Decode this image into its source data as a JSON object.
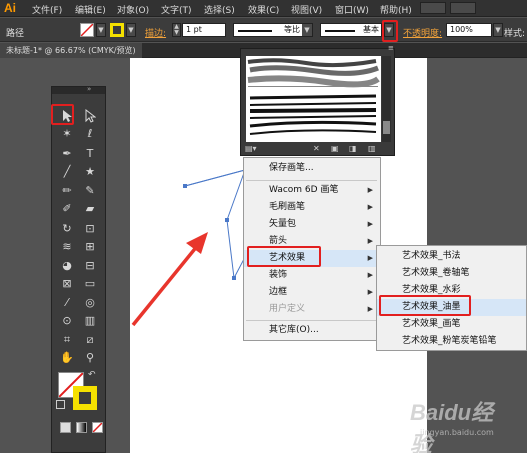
{
  "app": {
    "logo": "Ai"
  },
  "menubar": {
    "items": [
      "文件(F)",
      "编辑(E)",
      "对象(O)",
      "文字(T)",
      "选择(S)",
      "效果(C)",
      "视图(V)",
      "窗口(W)",
      "帮助(H)"
    ]
  },
  "control_bar": {
    "path_label": "路径",
    "stroke_label": "描边:",
    "stroke_weight": "1 pt",
    "profile_label": "等比",
    "brush_label": "基本",
    "opacity_label": "不透明度:",
    "opacity_value": "100%",
    "style_label": "样式:"
  },
  "doc_tab": {
    "title": "未标题-1* @ 66.67% (CMYK/预览)"
  },
  "context_menu": {
    "items": [
      "保存画笔...",
      "Wacom 6D 画笔",
      "毛刷画笔",
      "矢量包",
      "箭头",
      "艺术效果",
      "装饰",
      "边框",
      "用户定义",
      "其它库(O)..."
    ],
    "submenu_arrow": "▶"
  },
  "art_submenu": {
    "items": [
      "艺术效果_书法",
      "艺术效果_卷轴笔",
      "艺术效果_水彩",
      "艺术效果_油墨",
      "艺术效果_画笔",
      "艺术效果_粉笔炭笔铅笔"
    ]
  },
  "colors": {
    "accent_orange": "#ff9a00",
    "highlight_red": "#e21f1f",
    "arrow_red": "#e8352c",
    "path_blue": "#4a78c8",
    "fill_yellow": "#f5e100"
  },
  "icons": [
    "selection-arrow-icon",
    "direct-selection-icon",
    "magic-wand-icon",
    "lasso-icon",
    "pen-icon",
    "type-icon",
    "line-icon",
    "rectangle-icon",
    "paintbrush-icon",
    "pencil-icon",
    "blob-brush-icon",
    "eraser-icon",
    "rotate-icon",
    "scale-icon",
    "width-icon",
    "free-transform-icon",
    "shape-builder-icon",
    "perspective-icon",
    "mesh-icon",
    "gradient-icon",
    "eyedropper-icon",
    "blend-icon",
    "symbol-sprayer-icon",
    "column-graph-icon",
    "artboard-icon",
    "slice-icon",
    "hand-icon",
    "zoom-icon",
    "brush-library-icon",
    "chevron-down-icon"
  ],
  "watermark": {
    "text": "jingyan.baidu.com",
    "brand": "Baidu经验"
  }
}
